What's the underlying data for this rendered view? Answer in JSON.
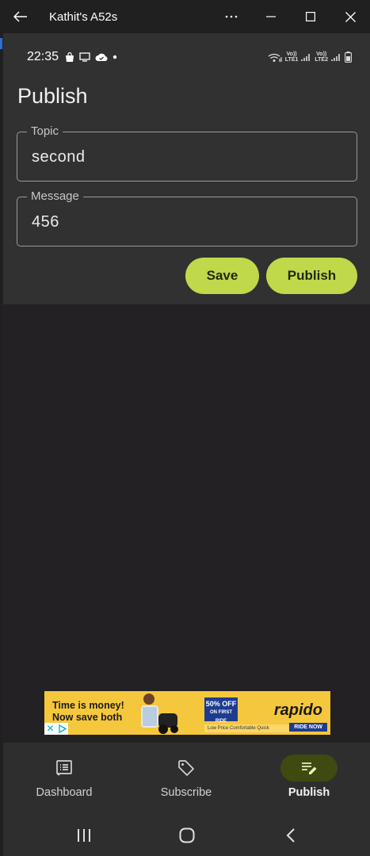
{
  "window": {
    "title": "Kathit's A52s",
    "buttons": [
      "back",
      "more",
      "minimize",
      "maximize",
      "close"
    ]
  },
  "statusbar": {
    "time": "22:35",
    "sim1_label_top": "Vo))",
    "sim1_label_bottom": "LTE1",
    "sim2_label_top": "Vo))",
    "sim2_label_bottom": "LTE2"
  },
  "screen": {
    "title": "Publish"
  },
  "form": {
    "topic_label": "Topic",
    "topic_value": "second",
    "message_label": "Message",
    "message_value": "456",
    "save_label": "Save",
    "publish_label": "Publish"
  },
  "ad": {
    "headline_1": "Time is money!",
    "headline_2": "Now save both",
    "offer": "50% OFF",
    "offer_sub": "ON FIRST RIDE",
    "brand": "rapido",
    "cta": "RIDE NOW",
    "features": "Low Price  Comfortable  Quick"
  },
  "bottom_nav": {
    "items": [
      {
        "label": "Dashboard",
        "icon": "dashboard-icon",
        "active": false
      },
      {
        "label": "Subscribe",
        "icon": "tag-icon",
        "active": false
      },
      {
        "label": "Publish",
        "icon": "publish-icon",
        "active": true
      }
    ]
  },
  "colors": {
    "accent": "#bfd94a",
    "active_nav_bg": "#3e4a0f",
    "background": "#232123",
    "surface": "#313131"
  }
}
